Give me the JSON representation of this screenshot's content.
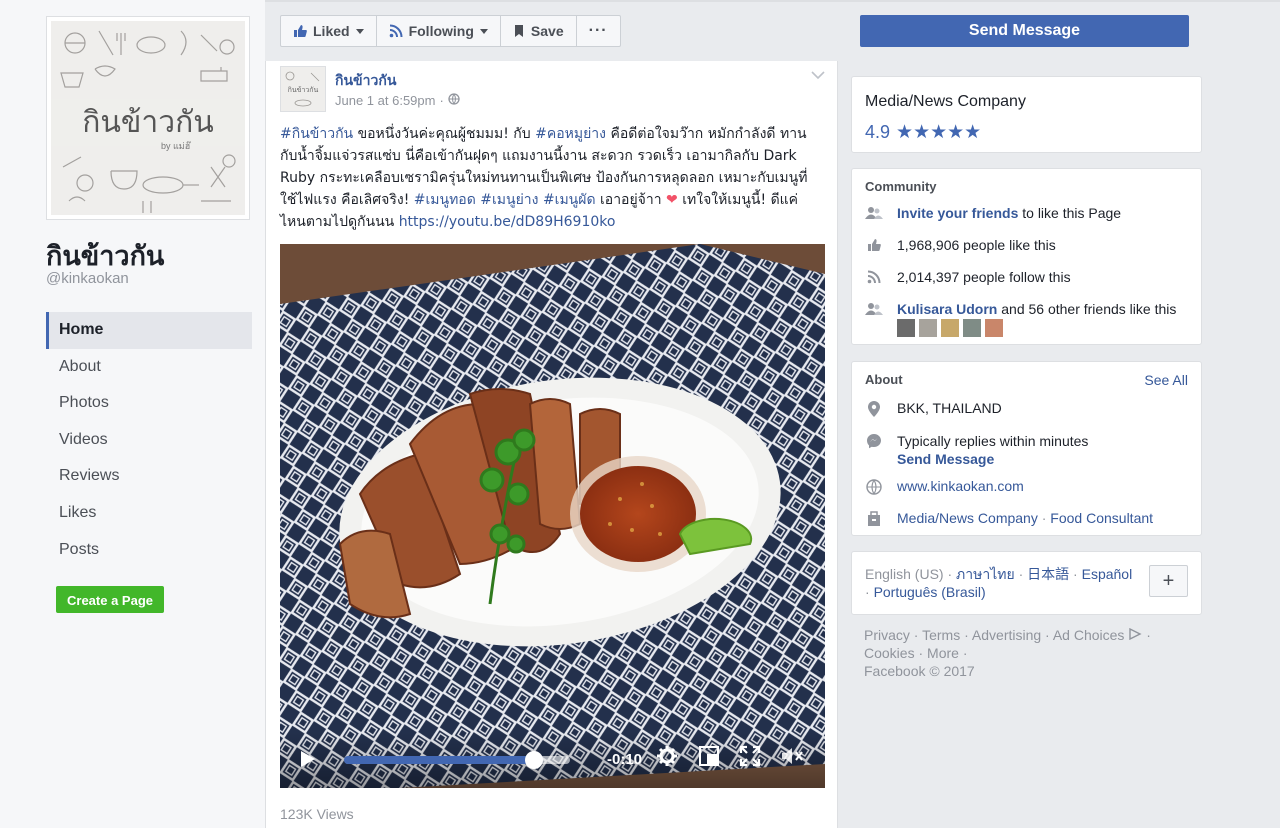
{
  "page": {
    "name": "กินข้าวกัน",
    "handle": "@kinkaokan",
    "profile_logo_text": "กินข้าวกัน",
    "profile_logo_sub": "by แม่ฮ๊"
  },
  "nav": {
    "items": [
      {
        "label": "Home",
        "active": true
      },
      {
        "label": "About"
      },
      {
        "label": "Photos"
      },
      {
        "label": "Videos"
      },
      {
        "label": "Reviews"
      },
      {
        "label": "Likes"
      },
      {
        "label": "Posts"
      }
    ],
    "create_page": "Create a Page"
  },
  "actions": {
    "liked": "Liked",
    "following": "Following",
    "save": "Save",
    "more": "···",
    "send_message": "Send Message"
  },
  "post": {
    "author": "กินข้าวกัน",
    "time": "June 1 at 6:59pm",
    "sep": "·",
    "text": {
      "tag1": "#กินข้าวกัน",
      "t1": " ขอหนึ่งวันค่ะคุณผู้ชมมม! กับ ",
      "tag2": "#คอหมูย่าง",
      "t2": " คือดีต่อใจมว๊าก หมักกำลังดี ทานกับน้ำจิ้มแจ่วรสแซ่บ นี่คือเข้ากันฝุดๆ แถมงานนี้งาน สะดวก รวดเร็ว เอามากิลกับ Dark Ruby กระทะเคลือบเซรามิครุ่นใหม่ทนทานเป็นพิเศษ ป้องกันการหลุดลอก เหมาะกับเมนูที่ใช้ไฟแรง คือเลิศจริง! ",
      "tag3": "#เมนูทอด",
      "tag4": "#เมนูย่าง",
      "tag5": "#เมนูผัด",
      "t3": " เอาอยู่จ้าา ",
      "heart": "❤",
      "t4": " เทใจให้เมนูนี้! ดีแค่ไหนตามไปดูกันนน ",
      "link": "https://youtu.be/dD89H6910ko"
    },
    "video": {
      "time": "-0:10",
      "progress": 0.84
    },
    "views": "123K Views"
  },
  "sidebar": {
    "category": "Media/News Company",
    "rating": "4.9",
    "stars": "★★★★★",
    "community": {
      "title": "Community",
      "invite_link": "Invite your friends",
      "invite_rest": " to like this Page",
      "likes": "1,968,906 people like this",
      "follows": "2,014,397 people follow this",
      "friend_name": "Kulisara Udorn",
      "friend_rest": " and 56 other friends like this"
    },
    "about": {
      "title": "About",
      "see_all": "See All",
      "location": "BKK, THAILAND",
      "replies": "Typically replies within minutes",
      "send_message": "Send Message",
      "website": "www.kinkaokan.com",
      "cat1": "Media/News Company",
      "dot": " · ",
      "cat2": "Food Consultant"
    },
    "languages": {
      "current": "English (US)",
      "sep": " · ",
      "thai": "ภาษาไทย",
      "japanese": "日本語",
      "spanish": "Español",
      "portuguese": "Português (Brasil)",
      "plus": "+"
    },
    "footer": {
      "privacy": "Privacy",
      "terms": "Terms",
      "advertising": "Advertising",
      "ad_choices": "Ad Choices",
      "cookies": "Cookies",
      "more": "More",
      "copyright": "Facebook © 2017",
      "sep": " · "
    }
  },
  "colors": {
    "brand": "#4267b2",
    "link": "#365899",
    "create_green": "#42b72a"
  }
}
